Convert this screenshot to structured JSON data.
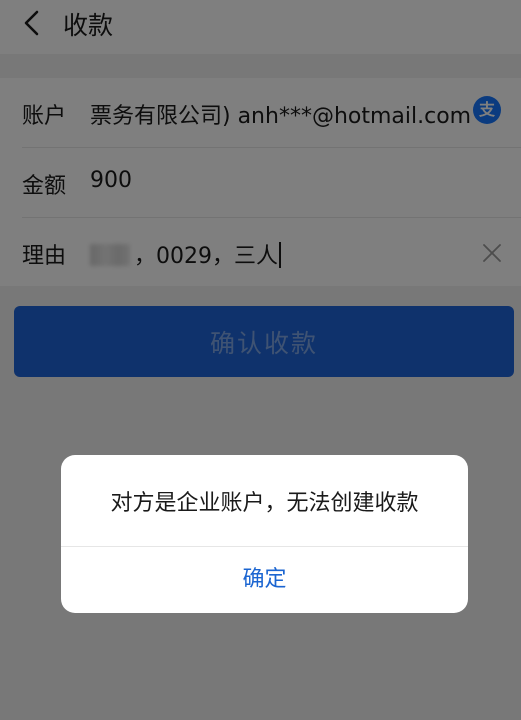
{
  "header": {
    "title": "收款"
  },
  "form": {
    "account_label": "账户",
    "account_value": "票务有限公司) anh***@hotmail.com",
    "account_icon": "支",
    "amount_label": "金额",
    "amount_value": "900",
    "reason_label": "理由",
    "reason_value": "，0029，三人"
  },
  "actions": {
    "confirm_label": "确认收款"
  },
  "dialog": {
    "message": "对方是企业账户，无法创建收款",
    "ok_label": "确定"
  },
  "colors": {
    "primary": "#1e65d8",
    "dialog_button": "#1b65d1",
    "alipay": "#1677ff"
  }
}
